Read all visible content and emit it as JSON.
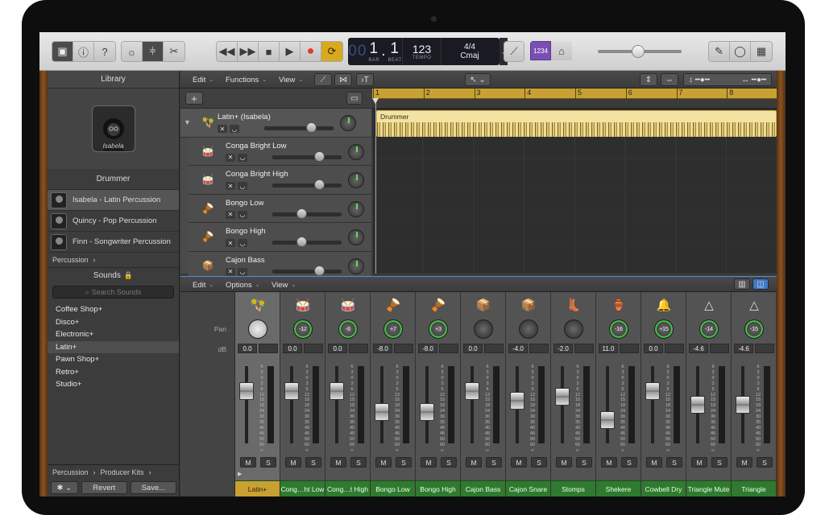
{
  "toolbar": {
    "lcd": {
      "bar": "1",
      "beat": "1",
      "bar_label": "BAR",
      "beat_label": "BEAT",
      "tempo": "123",
      "tempo_label": "TEMPO",
      "signature": "4/4",
      "key": "Cmaj",
      "prefix": "00"
    },
    "count_in": "1234"
  },
  "library": {
    "title": "Library",
    "avatar_name": "Isabela",
    "section": "Drummer",
    "drummers": [
      {
        "label": "Isabela - Latin Percussion",
        "selected": true
      },
      {
        "label": "Quincy - Pop Percussion",
        "selected": false
      },
      {
        "label": "Finn - Songwriter Percussion",
        "selected": false
      }
    ],
    "crumb": "Percussion",
    "crumb_chev": "›",
    "sounds_title": "Sounds",
    "search_placeholder": "Search Sounds",
    "sounds": [
      {
        "label": "Coffee Shop+",
        "selected": false
      },
      {
        "label": "Disco+",
        "selected": false
      },
      {
        "label": "Electronic+",
        "selected": false
      },
      {
        "label": "Latin+",
        "selected": true
      },
      {
        "label": "Pawn Shop+",
        "selected": false
      },
      {
        "label": "Retro+",
        "selected": false
      },
      {
        "label": "Studio+",
        "selected": false
      }
    ],
    "footer_crumb1": "Percussion",
    "footer_crumb2": "Producer Kits",
    "revert": "Revert",
    "save": "Save..."
  },
  "tracks_menu": {
    "edit": "Edit",
    "functions": "Functions",
    "view": "View"
  },
  "tracks": [
    {
      "name": "Latin+ (Isabela)",
      "vol": 0.72,
      "sub": false
    },
    {
      "name": "Conga Bright Low",
      "vol": 0.72,
      "sub": true
    },
    {
      "name": "Conga Bright High",
      "vol": 0.72,
      "sub": true
    },
    {
      "name": "Bongo Low",
      "vol": 0.45,
      "sub": true
    },
    {
      "name": "Bongo High",
      "vol": 0.45,
      "sub": true
    },
    {
      "name": "Cajon Bass",
      "vol": 0.72,
      "sub": true
    }
  ],
  "ruler": [
    "1",
    "2",
    "3",
    "4",
    "5",
    "6",
    "7",
    "8"
  ],
  "region": {
    "label": "Drummer"
  },
  "mixer_menu": {
    "edit": "Edit",
    "options": "Options",
    "view": "View"
  },
  "mixer_labels": {
    "pan": "Pan",
    "db": "dB"
  },
  "mixer_scale": [
    "6",
    "3",
    "0",
    "3",
    "6",
    "12",
    "15",
    "18",
    "24",
    "30",
    "35",
    "40",
    "45",
    "50",
    "60",
    "∞"
  ],
  "mixer_ms": {
    "m": "M",
    "s": "S"
  },
  "channels": [
    {
      "name": "Latin+",
      "pan": "",
      "db": "0.0",
      "fader": 0.73,
      "icon": "🪇"
    },
    {
      "name": "Cong…ht Low",
      "pan": "-12",
      "db": "0.0",
      "fader": 0.73,
      "icon": "🥁"
    },
    {
      "name": "Cong…t High",
      "pan": "-6",
      "db": "0.0",
      "fader": 0.73,
      "icon": "🥁"
    },
    {
      "name": "Bongo Low",
      "pan": "+7",
      "db": "-8.0",
      "fader": 0.45,
      "icon": "🪘"
    },
    {
      "name": "Bongo High",
      "pan": "+3",
      "db": "-8.0",
      "fader": 0.45,
      "icon": "🪘"
    },
    {
      "name": "Cajon Bass",
      "pan": "",
      "db": "0.0",
      "fader": 0.73,
      "icon": "📦"
    },
    {
      "name": "Cajon Snare",
      "pan": "",
      "db": "-4.0",
      "fader": 0.6,
      "icon": "📦"
    },
    {
      "name": "Stomps",
      "pan": "",
      "db": "-2.0",
      "fader": 0.66,
      "icon": "👢"
    },
    {
      "name": "Shekere",
      "pan": "-16",
      "db": "11.0",
      "fader": 0.33,
      "icon": "🏺"
    },
    {
      "name": "Cowbell Dry",
      "pan": "+15",
      "db": "0.0",
      "fader": 0.73,
      "icon": "🔔"
    },
    {
      "name": "Triangle Mute",
      "pan": "-14",
      "db": "-4.6",
      "fader": 0.55,
      "icon": "△"
    },
    {
      "name": "Triangle",
      "pan": "-15",
      "db": "-4.6",
      "fader": 0.55,
      "icon": "△"
    }
  ]
}
